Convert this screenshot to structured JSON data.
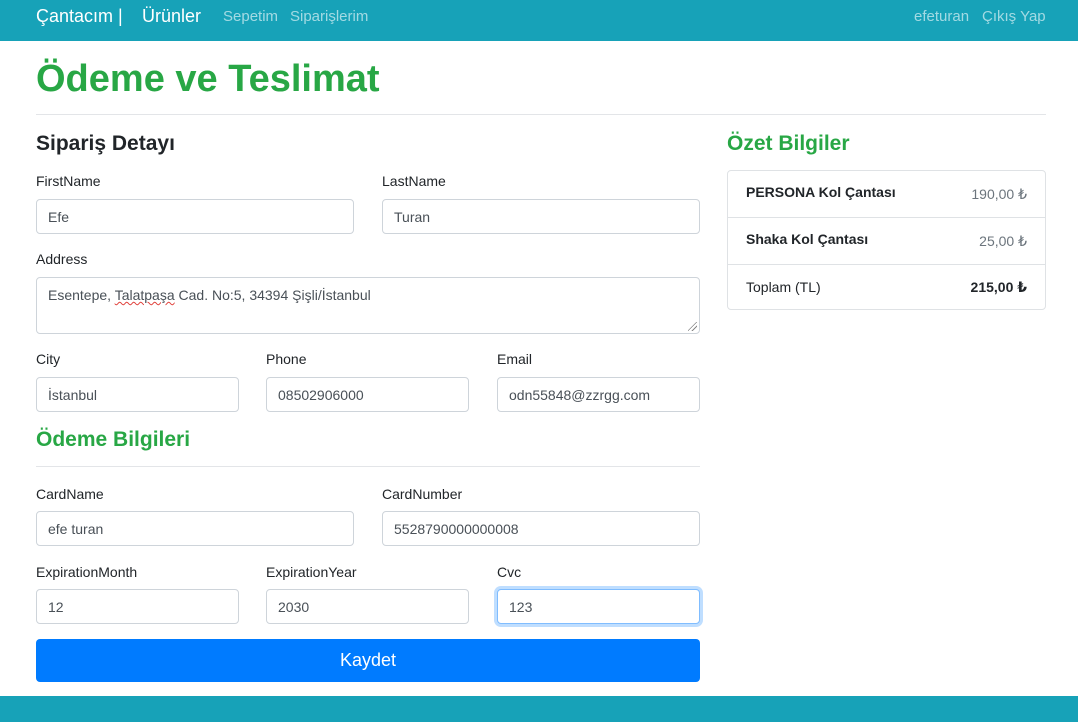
{
  "navbar": {
    "brand": "Çantacım |",
    "products": "Ürünler",
    "cart": "Sepetim",
    "orders": "Siparişlerim",
    "user": "efeturan",
    "logout": "Çıkış Yap"
  },
  "page_title": "Ödeme ve Teslimat",
  "order_details": {
    "title": "Sipariş Detayı",
    "first_name": {
      "label": "FirstName",
      "value": "Efe"
    },
    "last_name": {
      "label": "LastName",
      "value": "Turan"
    },
    "address": {
      "label": "Address",
      "value_before": "Esentepe, ",
      "value_misspelled": "Talatpaşa",
      "value_after": " Cad. No:5, 34394 Şişli/İstanbul"
    },
    "city": {
      "label": "City",
      "value": "İstanbul"
    },
    "phone": {
      "label": "Phone",
      "value": "08502906000"
    },
    "email": {
      "label": "Email",
      "value": "odn55848@zzrgg.com"
    }
  },
  "payment": {
    "title": "Ödeme Bilgileri",
    "card_name": {
      "label": "CardName",
      "value": "efe turan"
    },
    "card_number": {
      "label": "CardNumber",
      "value": "5528790000000008"
    },
    "exp_month": {
      "label": "ExpirationMonth",
      "value": "12"
    },
    "exp_year": {
      "label": "ExpirationYear",
      "value": "2030"
    },
    "cvc": {
      "label": "Cvc",
      "value": "123"
    }
  },
  "submit_label": "Kaydet",
  "summary": {
    "title": "Özet Bilgiler",
    "items": [
      {
        "name": "PERSONA Kol Çantası",
        "price": "190,00 ₺"
      },
      {
        "name": "Shaka Kol Çantası",
        "price": "25,00 ₺"
      }
    ],
    "total_label": "Toplam (TL)",
    "total_value": "215,00 ₺"
  },
  "colors": {
    "navbar": "#17a2b8",
    "heading_green": "#28a745",
    "primary_button": "#007bff"
  }
}
